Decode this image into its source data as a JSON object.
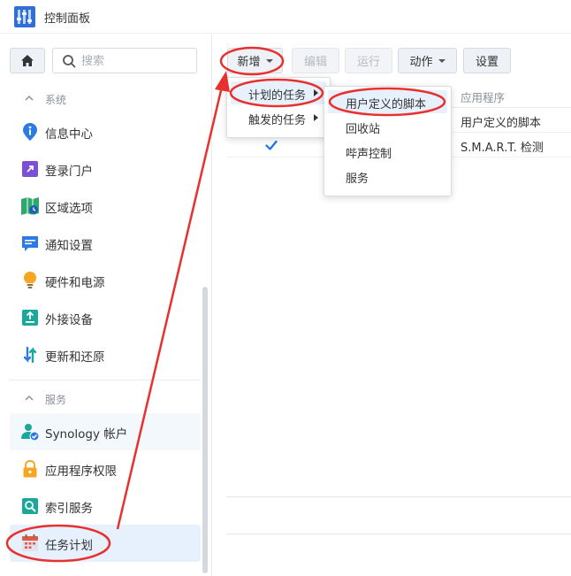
{
  "window": {
    "title": "控制面板"
  },
  "sidebar": {
    "search_placeholder": "搜索",
    "sections": [
      {
        "label": "系统"
      },
      {
        "label": "服务"
      }
    ],
    "system_items": [
      {
        "label": "信息中心",
        "icon": "info-icon"
      },
      {
        "label": "登录门户",
        "icon": "login-portal-icon"
      },
      {
        "label": "区域选项",
        "icon": "region-options-icon"
      },
      {
        "label": "通知设置",
        "icon": "notification-icon"
      },
      {
        "label": "硬件和电源",
        "icon": "lightbulb-icon"
      },
      {
        "label": "外接设备",
        "icon": "external-device-icon"
      },
      {
        "label": "更新和还原",
        "icon": "update-restore-icon"
      }
    ],
    "service_items": [
      {
        "label": "Synology 帐户",
        "icon": "synology-account-icon"
      },
      {
        "label": "应用程序权限",
        "icon": "lock-icon"
      },
      {
        "label": "索引服务",
        "icon": "index-service-icon"
      },
      {
        "label": "任务计划",
        "icon": "calendar-icon",
        "active": true
      }
    ]
  },
  "toolbar": {
    "create_label": "新增",
    "edit_label": "编辑",
    "run_label": "运行",
    "action_label": "动作",
    "settings_label": "设置"
  },
  "table": {
    "columns": {
      "app": "应用程序"
    },
    "rows": [
      {
        "checked": false,
        "app": "用户定义的脚本"
      },
      {
        "checked": true,
        "app": "S.M.A.R.T. 检测"
      }
    ]
  },
  "create_menu": {
    "items": [
      {
        "label": "计划的任务",
        "has_submenu": true,
        "hover": true
      },
      {
        "label": "触发的任务",
        "has_submenu": true
      }
    ]
  },
  "scheduled_submenu": {
    "items": [
      {
        "label": "用户定义的脚本",
        "hover": true
      },
      {
        "label": "回收站"
      },
      {
        "label": "哔声控制"
      },
      {
        "label": "服务"
      }
    ]
  },
  "colors": {
    "accent": "#1a73e8",
    "annotation_red": "#e8302f",
    "active_bg": "#e6f1fd"
  }
}
